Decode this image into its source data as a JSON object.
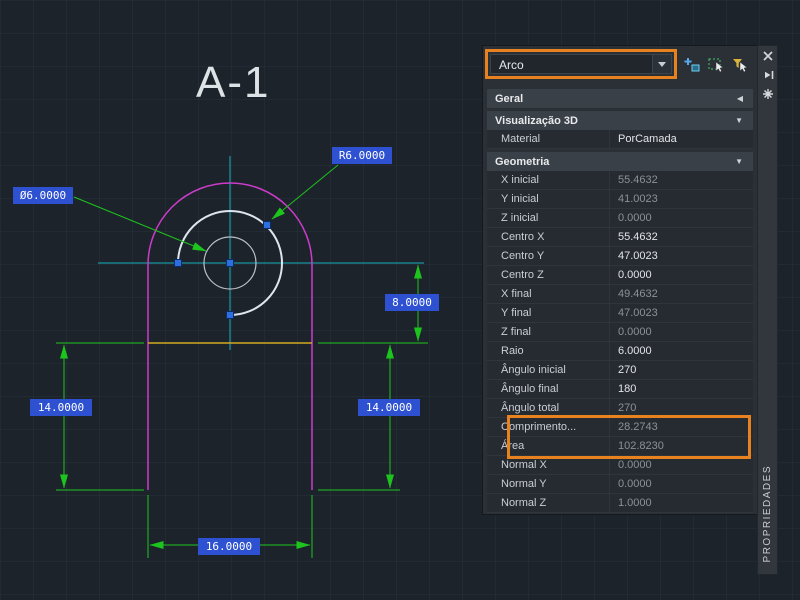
{
  "canvas": {
    "title": "A-1",
    "radius_label": "R6.0000",
    "diameter_label": "Ø6.0000",
    "dim_height_label": "8.0000",
    "dim_left_label": "14.0000",
    "dim_right_label": "14.0000",
    "dim_width_label": "16.0000",
    "colors": {
      "dimension_green": "#1ec41e",
      "geometry_magenta": "#cb3ccb",
      "chord_yellow": "#d2a91f",
      "crosshair_cyan": "#17b1c1",
      "arc_white": "#dde6ee",
      "circle_white": "#b9c0c6",
      "grip_blue": "#2e6fe0",
      "dim_chip_blue": "#2d51d0",
      "highlight_orange": "#e8821e"
    }
  },
  "panel": {
    "selector_value": "Arco",
    "side_tab": "PROPRIEDADES",
    "icons": {
      "toolbar": [
        "pickadd-toggle",
        "select-objects",
        "quick-select"
      ],
      "strip": [
        "close",
        "auto-hide",
        "settings"
      ],
      "dropdown": "chevron-down"
    },
    "rows": [
      {
        "type": "category",
        "label": "Geral",
        "arrow": "◀"
      },
      {
        "type": "category",
        "label": "Visualização 3D",
        "arrow": "▼"
      },
      {
        "type": "prop",
        "label": "Material",
        "value": "PorCamada"
      },
      {
        "type": "category",
        "label": "Geometria",
        "arrow": "▼"
      },
      {
        "type": "prop",
        "label": "X inicial",
        "value": "55.4632"
      },
      {
        "type": "prop",
        "label": "Y inicial",
        "value": "41.0023"
      },
      {
        "type": "prop",
        "label": "Z inicial",
        "value": "0.0000"
      },
      {
        "type": "prop",
        "label": "Centro X",
        "value": "55.4632"
      },
      {
        "type": "prop",
        "label": "Centro Y",
        "value": "47.0023"
      },
      {
        "type": "prop",
        "label": "Centro Z",
        "value": "0.0000"
      },
      {
        "type": "prop",
        "label": "X final",
        "value": "49.4632"
      },
      {
        "type": "prop",
        "label": "Y final",
        "value": "47.0023"
      },
      {
        "type": "prop",
        "label": "Z final",
        "value": "0.0000"
      },
      {
        "type": "prop",
        "label": "Raio",
        "value": "6.0000"
      },
      {
        "type": "prop",
        "label": "Ângulo inicial",
        "value": "270"
      },
      {
        "type": "prop",
        "label": "Ângulo final",
        "value": "180"
      },
      {
        "type": "prop",
        "label": "Ângulo total",
        "value": "270"
      },
      {
        "type": "prop",
        "label": "Comprimento...",
        "value": "28.2743"
      },
      {
        "type": "prop",
        "label": "Área",
        "value": "102.8230"
      },
      {
        "type": "prop",
        "label": "Normal X",
        "value": "0.0000"
      },
      {
        "type": "prop",
        "label": "Normal Y",
        "value": "0.0000"
      },
      {
        "type": "prop",
        "label": "Normal Z",
        "value": "1.0000"
      }
    ]
  }
}
